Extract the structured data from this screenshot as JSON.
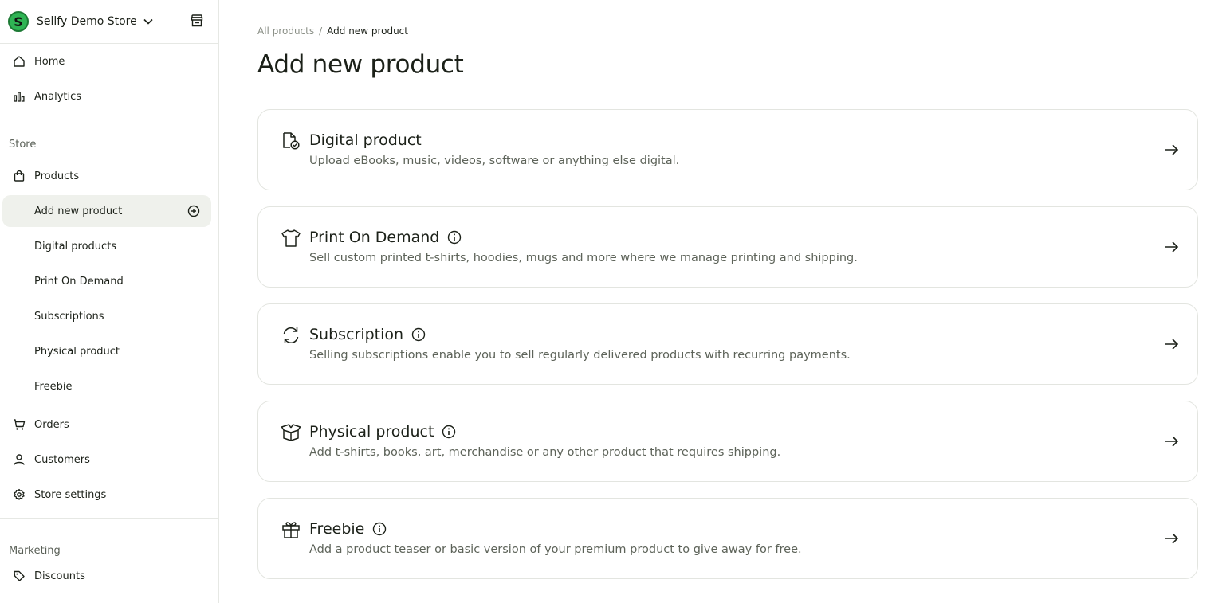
{
  "store": {
    "name": "Sellfy Demo Store",
    "logo_letter": "S"
  },
  "sidebar": {
    "top_items": [
      {
        "label": "Home",
        "icon": "home-icon"
      },
      {
        "label": "Analytics",
        "icon": "bar-chart-icon"
      }
    ],
    "store_section": "Store",
    "products": {
      "label": "Products",
      "icon": "shopping-bag-icon"
    },
    "product_subitems": [
      {
        "label": "Add new product",
        "active": true
      },
      {
        "label": "Digital products"
      },
      {
        "label": "Print On Demand"
      },
      {
        "label": "Subscriptions"
      },
      {
        "label": "Physical product"
      },
      {
        "label": "Freebie"
      }
    ],
    "store_items": [
      {
        "label": "Orders",
        "icon": "cart-icon"
      },
      {
        "label": "Customers",
        "icon": "user-icon"
      },
      {
        "label": "Store settings",
        "icon": "gear-icon"
      }
    ],
    "marketing_section": "Marketing",
    "marketing_items": [
      {
        "label": "Discounts",
        "icon": "tag-icon"
      }
    ]
  },
  "breadcrumb": {
    "parent": "All products",
    "separator": "/",
    "current": "Add new product"
  },
  "page": {
    "title": "Add new product"
  },
  "product_types": [
    {
      "title": "Digital product",
      "description": "Upload eBooks, music, videos, software or anything else digital.",
      "icon": "digital-file-icon",
      "info": false
    },
    {
      "title": "Print On Demand",
      "description": "Sell custom printed t-shirts, hoodies, mugs and more where we manage printing and shipping.",
      "icon": "tshirt-icon",
      "info": true
    },
    {
      "title": "Subscription",
      "description": "Selling subscriptions enable you to sell regularly delivered products with recurring payments.",
      "icon": "refresh-icon",
      "info": true
    },
    {
      "title": "Physical product",
      "description": "Add t-shirts, books, art, merchandise or any other product that requires shipping.",
      "icon": "open-box-icon",
      "info": true
    },
    {
      "title": "Freebie",
      "description": "Add a product teaser or basic version of your premium product to give away for free.",
      "icon": "gift-icon",
      "info": true
    }
  ],
  "colors": {
    "brand_green": "#2fb454",
    "active_bg": "#eff1ec",
    "text_dark": "#1c2119",
    "text_muted": "#5d6359"
  }
}
